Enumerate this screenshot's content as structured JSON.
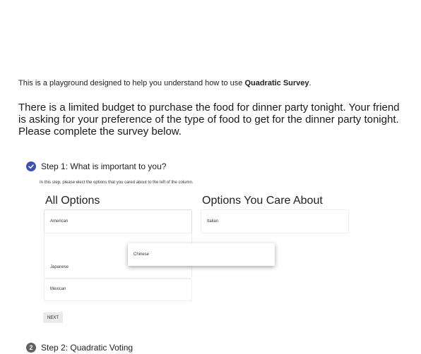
{
  "intro": {
    "prefix": "This is a playground designed to help you understand how to use ",
    "brand": "Quadratic Survey",
    "suffix": "."
  },
  "scenario": "There is a limited budget to purchase the food for dinner party tonight. Your friend is asking for your preference of the type of food to get for the dinner party tonight. Please complete the survey below.",
  "steps": [
    {
      "title": "Step 1: What is important to you?",
      "icon": "check-circle-icon",
      "helper": "In this step, please elect the options that you cared about to the left of the column."
    },
    {
      "title": "Step 2: Quadratic Voting",
      "number": "2"
    }
  ],
  "columns": {
    "all_options": "All Options",
    "care_about": "Options You Care About"
  },
  "all_options": [
    "American",
    "Japanese",
    "Mexican"
  ],
  "care_options": [
    "Italian"
  ],
  "dragging_item": "Chinese",
  "next_label": "NEXT",
  "colors": {
    "accent": "#3f51b5",
    "step_inactive": "#616161"
  }
}
